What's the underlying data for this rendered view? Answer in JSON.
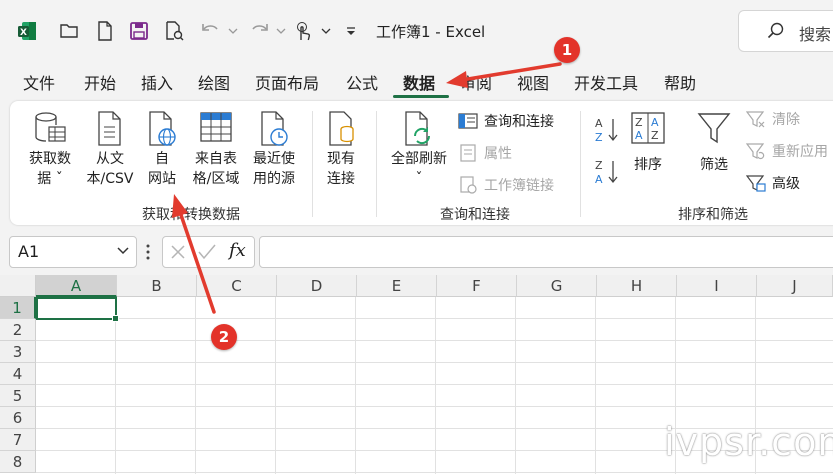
{
  "window": {
    "title": "工作簿1  -  Excel",
    "search_placeholder": "搜索"
  },
  "tabs": [
    "文件",
    "开始",
    "插入",
    "绘图",
    "页面布局",
    "公式",
    "数据",
    "审阅",
    "视图",
    "开发工具",
    "帮助"
  ],
  "active_tab": "数据",
  "ribbon": {
    "get_data": {
      "line1": "获取数",
      "line2": "据 ˇ"
    },
    "from_csv": {
      "line1": "从文",
      "line2": "本/CSV"
    },
    "from_web": {
      "line1": "自",
      "line2": "网站"
    },
    "from_table": {
      "line1": "来自表",
      "line2": "格/区域"
    },
    "recent": {
      "line1": "最近使",
      "line2": "用的源"
    },
    "existing": {
      "line1": "现有",
      "line2": "连接"
    },
    "group1_label": "获取和转换数据",
    "refresh_all": {
      "line1": "全部刷新",
      "line2": "ˇ"
    },
    "queries_connections": "查询和连接",
    "properties": "属性",
    "edit_links": "工作簿链接",
    "group2_label": "查询和连接",
    "sort_az": "A→Z",
    "sort": "排序",
    "filter": "筛选",
    "clear": "清除",
    "reapply": "重新应用",
    "advanced": "高级",
    "group3_label": "排序和筛选"
  },
  "formula_bar": {
    "name_box": "A1",
    "fx": "fx"
  },
  "columns": [
    "A",
    "B",
    "C",
    "D",
    "E",
    "F",
    "G",
    "H",
    "I",
    "J"
  ],
  "rows": [
    "1",
    "2",
    "3",
    "4",
    "5",
    "6",
    "7",
    "8"
  ],
  "annotations": {
    "badge1": "1",
    "badge2": "2"
  },
  "watermark": "ivpsr.com",
  "colors": {
    "excel_green": "#1e7145",
    "badge_red": "#e3332a",
    "arrow_red": "#e23b2e"
  }
}
